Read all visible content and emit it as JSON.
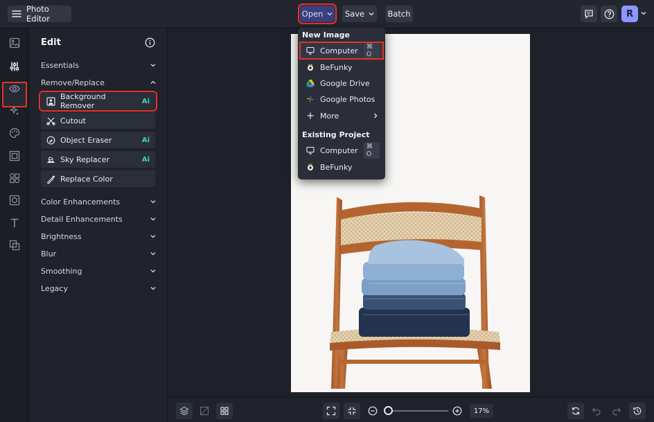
{
  "app": {
    "title": "Photo Editor"
  },
  "toolbar": {
    "open_label": "Open",
    "save_label": "Save",
    "batch_label": "Batch"
  },
  "user": {
    "initial": "R"
  },
  "open_menu": {
    "new_image_heading": "New Image",
    "new_image_items": [
      {
        "label": "Computer",
        "shortcut": "⌘ O",
        "icon": "monitor-icon"
      },
      {
        "label": "BeFunky",
        "icon": "befunky-logo-icon"
      },
      {
        "label": "Google Drive",
        "icon": "google-drive-icon"
      },
      {
        "label": "Google Photos",
        "icon": "google-photos-icon"
      },
      {
        "label": "More",
        "icon": "plus-icon"
      }
    ],
    "existing_project_heading": "Existing Project",
    "existing_project_items": [
      {
        "label": "Computer",
        "shortcut": "⌘ O",
        "icon": "monitor-icon"
      },
      {
        "label": "BeFunky",
        "icon": "befunky-logo-icon"
      }
    ]
  },
  "edit_panel": {
    "title": "Edit",
    "essentials": "Essentials",
    "remove_replace": "Remove/Replace",
    "tools": [
      {
        "label": "Background Remover",
        "badge": "Ai",
        "icon": "portrait-icon"
      },
      {
        "label": "Cutout",
        "icon": "scissors-icon"
      },
      {
        "label": "Object Eraser",
        "badge": "Ai",
        "icon": "eraser-icon"
      },
      {
        "label": "Sky Replacer",
        "badge": "Ai",
        "icon": "sky-icon"
      },
      {
        "label": "Replace Color",
        "icon": "eyedropper-icon"
      }
    ],
    "sections": [
      "Color Enhancements",
      "Detail Enhancements",
      "Brightness",
      "Blur",
      "Smoothing",
      "Legacy"
    ]
  },
  "zoom": {
    "percent": "17%",
    "slider_fraction": 0.0
  },
  "colors": {
    "accent_red": "#e5332a",
    "ai_badge": "#3fd5b2",
    "avatar": "#8c96ff"
  }
}
